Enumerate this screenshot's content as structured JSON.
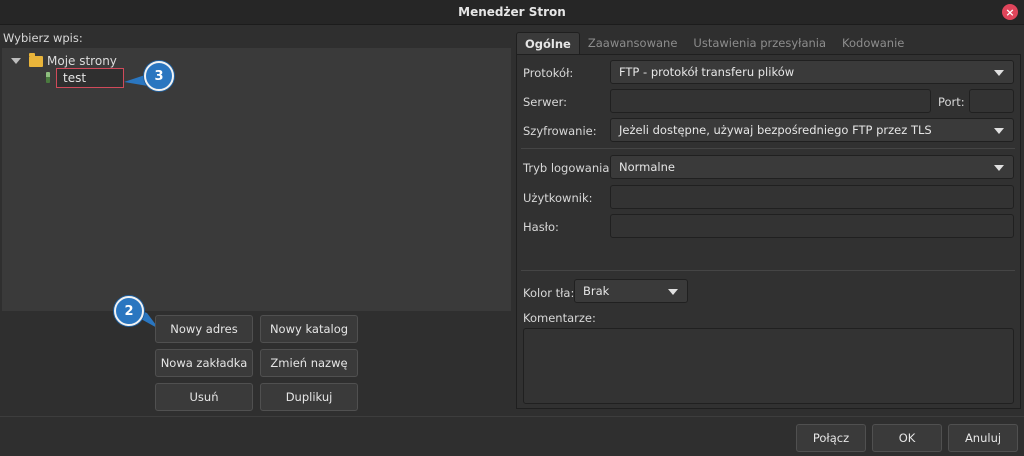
{
  "window": {
    "title": "Menedżer Stron",
    "close_glyph": "×"
  },
  "left": {
    "label": "Wybierz wpis:",
    "tree": {
      "folder": {
        "label": "Moje strony",
        "icon": "folder-icon"
      },
      "site": {
        "label": "test",
        "icon": "site-icon"
      }
    },
    "buttons": {
      "new_site": "Nowy adres",
      "new_folder": "Nowy katalog",
      "new_bookmark": "Nowa zakładka",
      "rename": "Zmień nazwę",
      "delete": "Usuń",
      "duplicate": "Duplikuj"
    },
    "callouts": {
      "step2": "2",
      "step3": "3"
    }
  },
  "tabs": [
    "Ogólne",
    "Zaawansowane",
    "Ustawienia przesyłania",
    "Kodowanie"
  ],
  "general": {
    "protocol": {
      "label": "Protokół:",
      "value": "FTP - protokół transferu plików"
    },
    "host": {
      "label": "Serwer:",
      "value": ""
    },
    "port": {
      "label": "Port:",
      "value": ""
    },
    "encryption": {
      "label": "Szyfrowanie:",
      "value": "Jeżeli dostępne, używaj bezpośredniego FTP przez TLS"
    },
    "logon": {
      "label": "Tryb logowania:",
      "value": "Normalne"
    },
    "user": {
      "label": "Użytkownik:",
      "value": ""
    },
    "password": {
      "label": "Hasło:",
      "value": ""
    },
    "bg_color": {
      "label": "Kolor tła:",
      "value": "Brak"
    },
    "comments": {
      "label": "Komentarze:",
      "value": ""
    }
  },
  "footer": {
    "connect": "Połącz",
    "ok": "OK",
    "cancel": "Anuluj"
  },
  "colors": {
    "accent": "#2a76c0",
    "edit_border": "#d04a5a",
    "close": "#e0455b"
  }
}
